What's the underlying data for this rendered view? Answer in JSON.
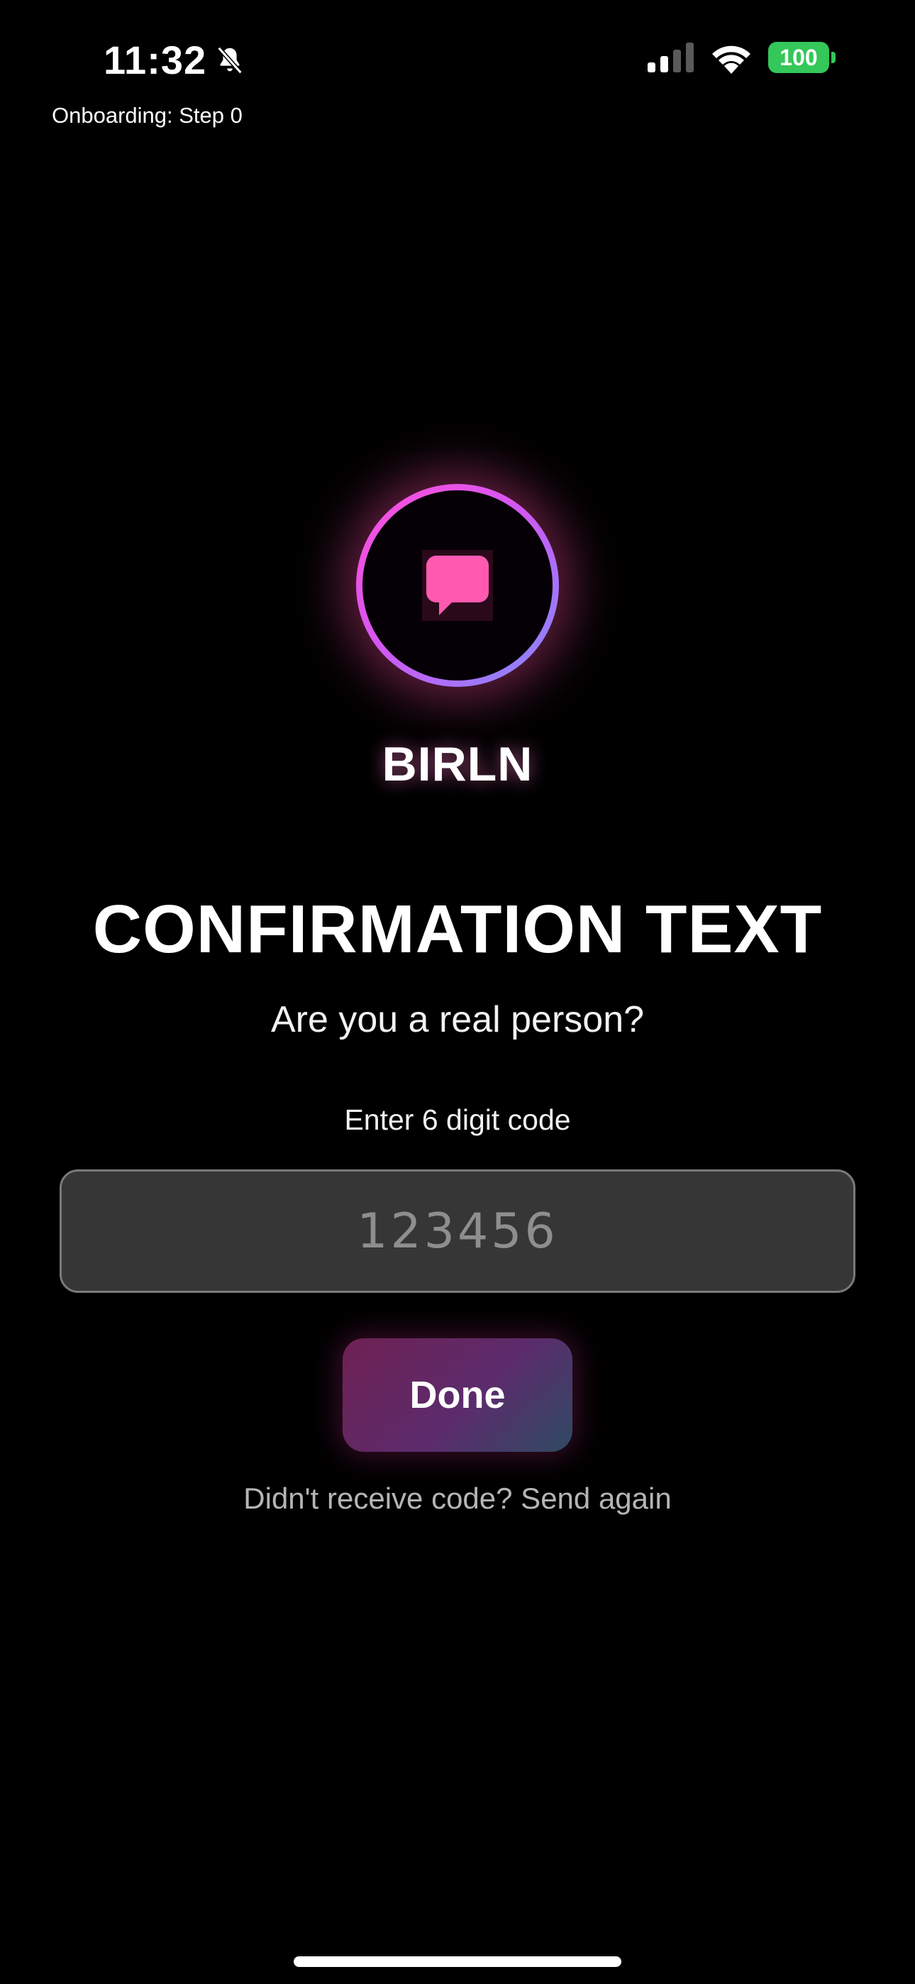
{
  "status_bar": {
    "time": "11:32",
    "silent_icon": "bell-slash-icon",
    "signal_icon": "cellular-signal-icon",
    "wifi_icon": "wifi-icon",
    "battery_level": "100",
    "battery_color": "#34c759"
  },
  "debug": {
    "onboarding_label": "Onboarding: Step 0"
  },
  "logo": {
    "icon": "chat-bubble-icon",
    "brand_name": "BIRLN",
    "ring_colors": [
      "#ff4fd8",
      "#d456f2",
      "#7f8cff"
    ]
  },
  "main": {
    "title": "CONFIRMATION TEXT",
    "subtitle": "Are you a real person?",
    "code_label": "Enter 6 digit code",
    "code_input": {
      "value": "",
      "placeholder": "123456"
    },
    "done_label": "Done",
    "resend_text": "Didn't receive code? Send again"
  }
}
